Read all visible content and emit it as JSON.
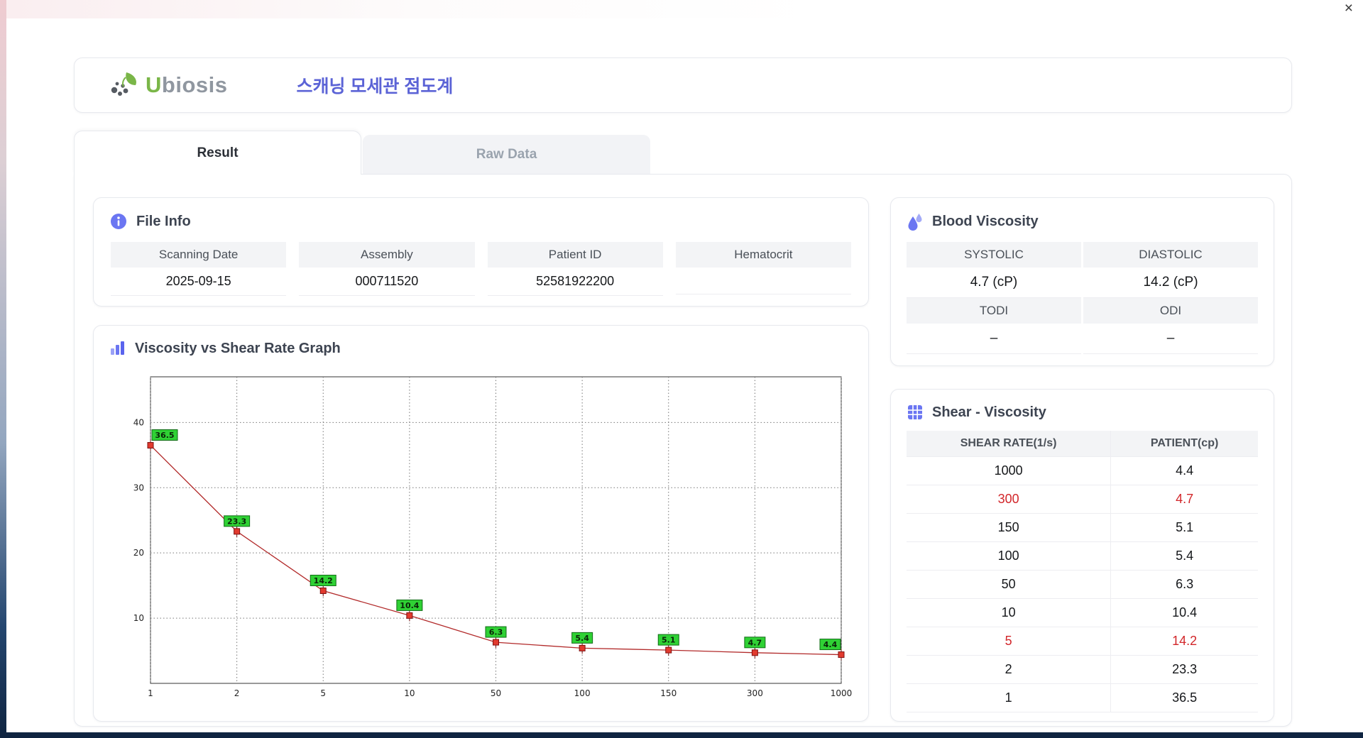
{
  "window": {
    "close_label": "×"
  },
  "header": {
    "logo_first": "U",
    "logo_rest": "biosis",
    "title": "스캐닝 모세관 점도계"
  },
  "tabs": [
    {
      "label": "Result",
      "active": true
    },
    {
      "label": "Raw Data",
      "active": false
    }
  ],
  "file_info": {
    "title": "File Info",
    "fields": [
      {
        "label": "Scanning Date",
        "value": "2025-09-15"
      },
      {
        "label": "Assembly",
        "value": "000711520"
      },
      {
        "label": "Patient ID",
        "value": "52581922200"
      },
      {
        "label": "Hematocrit",
        "value": ""
      }
    ]
  },
  "graph": {
    "title": "Viscosity vs Shear Rate Graph"
  },
  "chart_data": {
    "type": "line",
    "title": "Viscosity vs Shear Rate Graph",
    "x": [
      1,
      2,
      5,
      10,
      50,
      100,
      150,
      300,
      1000
    ],
    "x_ticks": [
      "1",
      "2",
      "5",
      "10",
      "50",
      "100",
      "150",
      "300",
      "1000"
    ],
    "x_scale": "category",
    "values": [
      36.5,
      23.3,
      14.2,
      10.4,
      6.3,
      5.4,
      5.1,
      4.7,
      4.4
    ],
    "y_ticks": [
      10,
      20,
      30,
      40
    ],
    "ylim": [
      0,
      47
    ],
    "grid": "dotted",
    "legend": "none",
    "line_color": "#b22a2a",
    "marker_color": "#e23a2e",
    "marker_edge_color": "#7d1010",
    "label_bg": "#2fd134",
    "label_border": "#116b16",
    "label_text_color": "#0a2408"
  },
  "blood_viscosity": {
    "title": "Blood Viscosity",
    "rows": [
      [
        {
          "label": "SYSTOLIC",
          "value": "4.7 (cP)"
        },
        {
          "label": "DIASTOLIC",
          "value": "14.2 (cP)"
        }
      ],
      [
        {
          "label": "TODI",
          "value": "–"
        },
        {
          "label": "ODI",
          "value": "–"
        }
      ]
    ]
  },
  "shear_viscosity": {
    "title": "Shear - Viscosity",
    "headers": [
      "SHEAR RATE(1/s)",
      "PATIENT(cp)"
    ],
    "rows": [
      {
        "shear": "1000",
        "patient": "4.4",
        "highlight": false
      },
      {
        "shear": "300",
        "patient": "4.7",
        "highlight": true
      },
      {
        "shear": "150",
        "patient": "5.1",
        "highlight": false
      },
      {
        "shear": "100",
        "patient": "5.4",
        "highlight": false
      },
      {
        "shear": "50",
        "patient": "6.3",
        "highlight": false
      },
      {
        "shear": "10",
        "patient": "10.4",
        "highlight": false
      },
      {
        "shear": "5",
        "patient": "14.2",
        "highlight": true
      },
      {
        "shear": "2",
        "patient": "23.3",
        "highlight": false
      },
      {
        "shear": "1",
        "patient": "36.5",
        "highlight": false
      }
    ]
  },
  "colors": {
    "accent_indigo": "#6b76f2",
    "title_indigo": "#5b63d6",
    "logo_green": "#7ab648",
    "highlight_red": "#d2262a"
  }
}
